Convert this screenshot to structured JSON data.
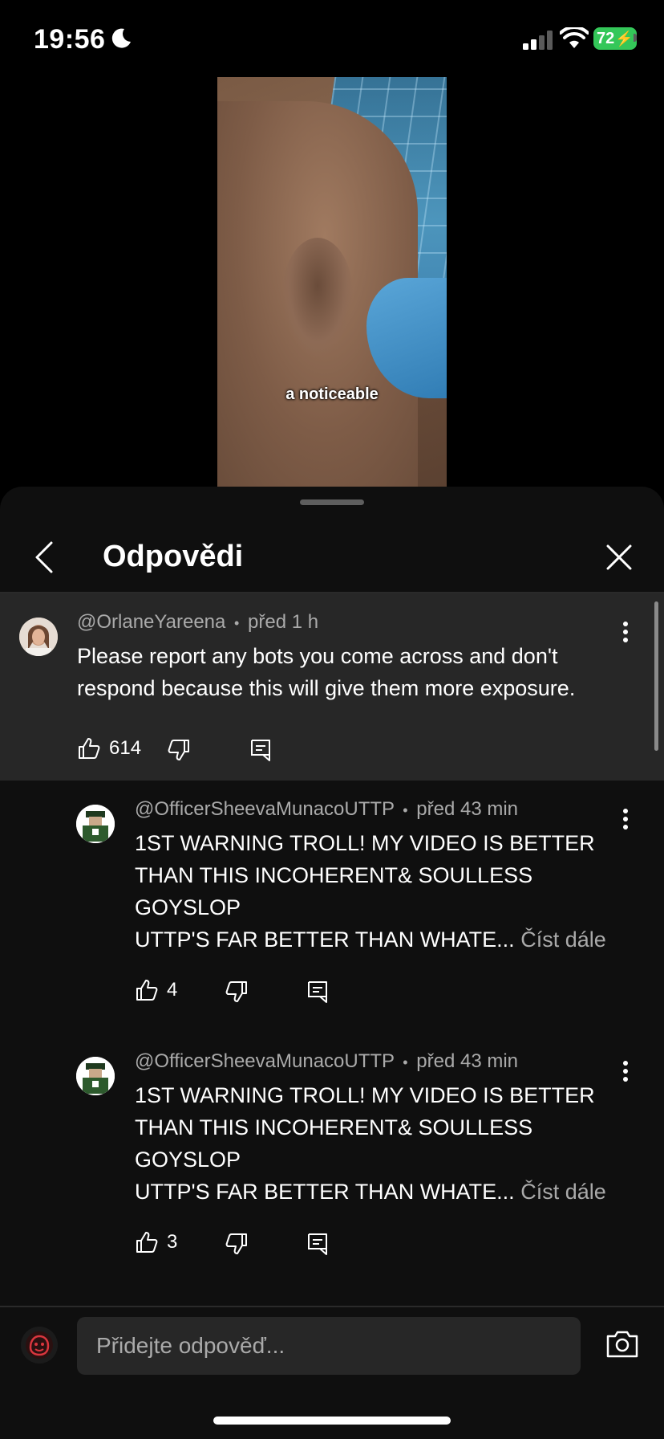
{
  "status_bar": {
    "time": "19:56",
    "battery": "72"
  },
  "video": {
    "caption": "a noticeable"
  },
  "sheet": {
    "title": "Odpovědi"
  },
  "parent_comment": {
    "author": "@OrlaneYareena",
    "time": "před 1 h",
    "separator": "•",
    "text_line1": "Please report any bots you come across and don't",
    "text_line2": "respond because this will give them more exposure.",
    "likes": "614"
  },
  "replies": [
    {
      "author": "@OfficerSheevaMunacoUTTP",
      "time": "před 43 min",
      "separator": "•",
      "line1": "1ST WARNING TROLL! MY VIDEO IS BETTER",
      "line2": "THAN THIS INCOHERENT& SOULLESS",
      "line3": "GOYSLOP",
      "line4": "UTTP'S FAR BETTER THAN WHATE...",
      "read_more": "Číst dále",
      "likes": "4"
    },
    {
      "author": "@OfficerSheevaMunacoUTTP",
      "time": "před 43 min",
      "separator": "•",
      "line1": "1ST WARNING TROLL! MY VIDEO IS BETTER",
      "line2": "THAN THIS INCOHERENT& SOULLESS",
      "line3": "GOYSLOP",
      "line4": "UTTP'S FAR BETTER THAN WHATE...",
      "read_more": "Číst dále",
      "likes": "3"
    }
  ],
  "composer": {
    "placeholder": "Přidejte odpověď..."
  },
  "colors": {
    "sheet_bg": "#0f0f0f",
    "highlight_bg": "#272727",
    "secondary_text": "#aaaaaa",
    "battery": "#34c759"
  },
  "icons": [
    "moon-icon",
    "signal-icon",
    "wifi-icon",
    "back-icon",
    "close-icon",
    "more-vert-icon",
    "thumb-up-icon",
    "thumb-down-icon",
    "reply-icon",
    "camera-icon"
  ]
}
